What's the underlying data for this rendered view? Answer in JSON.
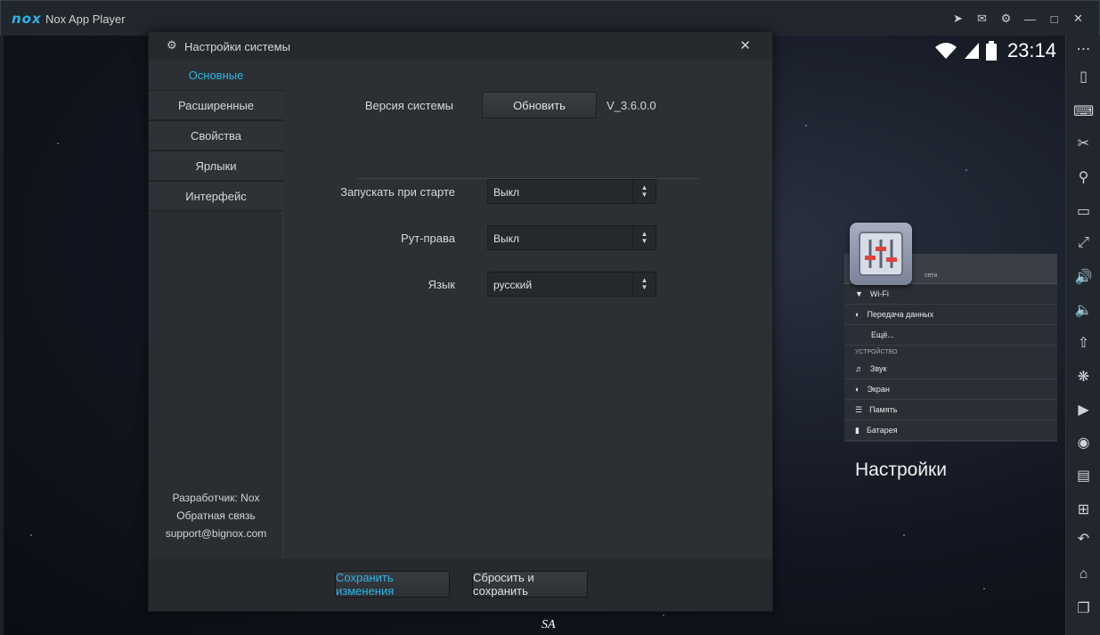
{
  "window": {
    "logo": "nox",
    "title": "Nox App Player",
    "titlebar_icons": [
      "pin-icon",
      "mail-icon",
      "gear-icon",
      "minimize-icon",
      "maximize-icon",
      "close-icon"
    ]
  },
  "status_bar": {
    "time": "23:14",
    "icons": [
      "wifi-icon",
      "signal-icon",
      "battery-icon"
    ]
  },
  "recent_app": {
    "label": "Настройки",
    "rows": [
      {
        "icon": "wifi-icon",
        "text": "Wi-Fi"
      },
      {
        "icon": "data-icon",
        "text": "Передача данных"
      },
      {
        "icon": "",
        "text": "Ещё..."
      }
    ],
    "section_top": "сети",
    "section": "УСТРОЙСТВО",
    "rows2": [
      {
        "icon": "sound-icon",
        "text": "Звук"
      },
      {
        "icon": "screen-icon",
        "text": "Экран"
      },
      {
        "icon": "memory-icon",
        "text": "Память"
      },
      {
        "icon": "battery-icon",
        "text": "Батарея"
      }
    ]
  },
  "dialog": {
    "title": "Настройки системы",
    "nav": [
      {
        "label": "Основные",
        "active": true
      },
      {
        "label": "Расширенные",
        "active": false
      },
      {
        "label": "Свойства",
        "active": false
      },
      {
        "label": "Ярлыки",
        "active": false
      },
      {
        "label": "Интерфейс",
        "active": false
      }
    ],
    "developer": "Разработчик: Nox",
    "feedback": "Обратная связь",
    "email": "support@bignox.com",
    "version_label": "Версия системы",
    "update_button": "Обновить",
    "version_value": "V_3.6.0.0",
    "settings": [
      {
        "label": "Запускать при старте",
        "value": "Выкл"
      },
      {
        "label": "Рут-права",
        "value": "Выкл"
      },
      {
        "label": "Язык",
        "value": "русский"
      }
    ],
    "save_button": "Сохранить изменения",
    "reset_button": "Сбросить и сохранить"
  },
  "side_toolbar": [
    "more-icon",
    "shake-icon",
    "keyboard-icon",
    "scissors-icon",
    "location-icon",
    "screen-icon",
    "fullscreen-icon",
    "volume-up-icon",
    "volume-down-icon",
    "apk-install-icon",
    "loading-icon",
    "macro-icon",
    "video-record-icon",
    "multi-instance-icon",
    "add-icon",
    "back-icon",
    "home-icon",
    "recent-apps-icon"
  ],
  "watermark": "SA"
}
